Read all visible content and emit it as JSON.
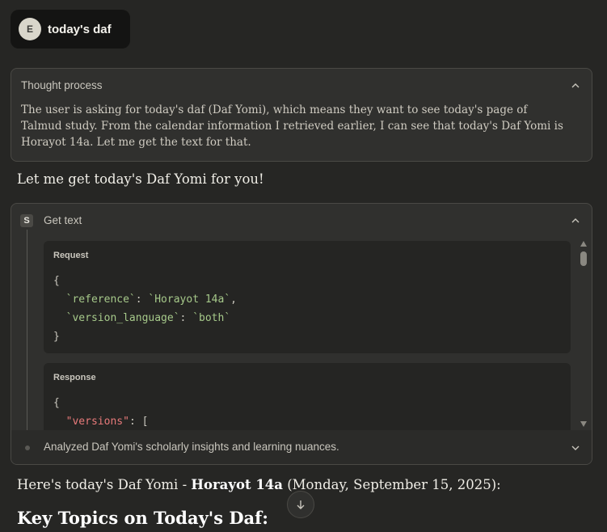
{
  "user_message": {
    "avatar_initial": "E",
    "text": "today's daf"
  },
  "thought": {
    "title": "Thought process",
    "body": "The user is asking for today's daf (Daf Yomi), which means they want to see today's page of Talmud study. From the calendar information I retrieved earlier, I can see that today's Daf Yomi is Horayot 14a. Let me get the text for that."
  },
  "intro_text": "Let me get today's Daf Yomi for you!",
  "tool": {
    "badge": "S",
    "title": "Get text",
    "request": {
      "label": "Request",
      "open_brace": "{",
      "lines": [
        {
          "key": "`reference`",
          "sep": ": ",
          "value": "`Horayot 14a`",
          "end": ","
        },
        {
          "key": "`version_language`",
          "sep": ": ",
          "value": "`both`",
          "end": ""
        }
      ],
      "close_brace": "}"
    },
    "response": {
      "label": "Response",
      "open_brace": "{",
      "key": "\"versions\"",
      "rest": ": ["
    },
    "analyzed_text": "Analyzed Daf Yomi's scholarly insights and learning nuances."
  },
  "answer": {
    "prefix": "Here's today's Daf Yomi - ",
    "bold": "Horayot 14a",
    "suffix": " (Monday, September 15, 2025):"
  },
  "heading": "Key Topics on Today's Daf:",
  "icons": {
    "collapse_thought": "chevron-up-icon",
    "collapse_tool": "chevron-up-icon",
    "expand_analyzed": "chevron-down-icon",
    "scroll_down": "arrow-down-icon"
  }
}
